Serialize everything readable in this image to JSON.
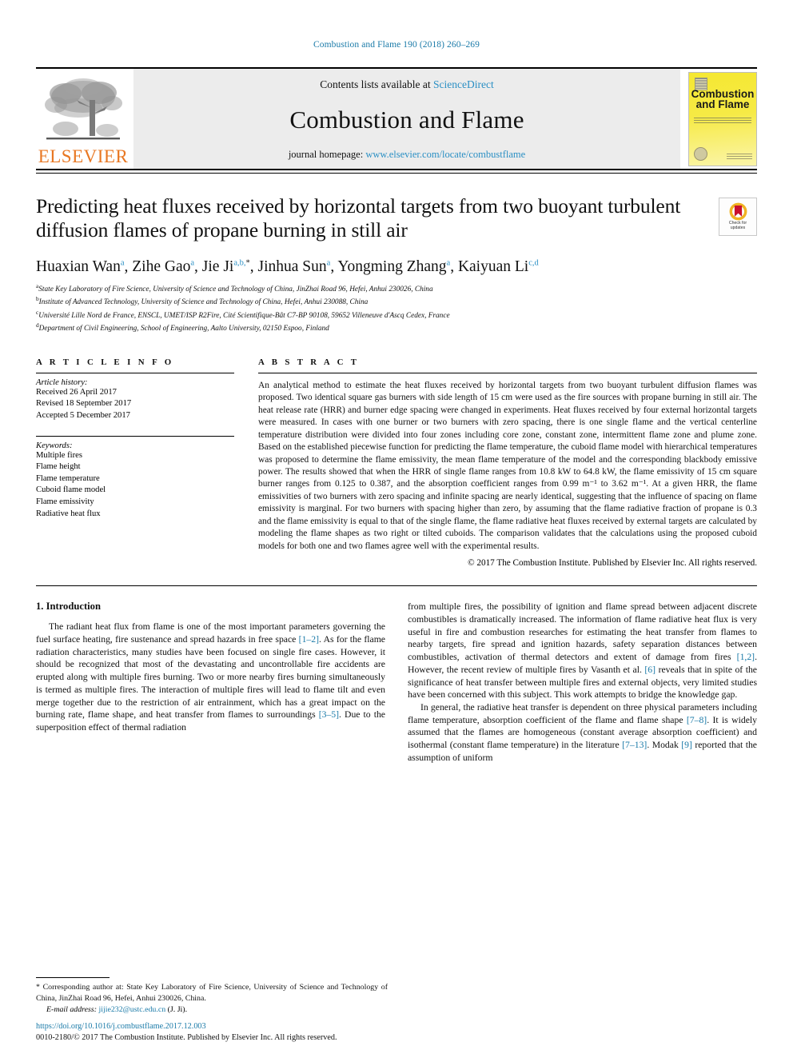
{
  "running_head": "Combustion and Flame 190 (2018) 260–269",
  "masthead": {
    "publisher": "ELSEVIER",
    "contents_prefix": "Contents lists available at ",
    "contents_link": "ScienceDirect",
    "journal_name": "Combustion and Flame",
    "homepage_prefix": "journal homepage: ",
    "homepage_url": "www.elsevier.com/locate/combustflame",
    "cover_title_line1": "Combustion",
    "cover_title_line2": "and Flame"
  },
  "article": {
    "title": "Predicting heat fluxes received by horizontal targets from two buoyant turbulent diffusion flames of propane burning in still air",
    "crossmark_line1": "Check for",
    "crossmark_line2": "updates",
    "authors_html": "Huaxian Wan<sup>a</sup>, Zihe Gao<sup>a</sup>, Jie Ji<sup>a,b,</sup><sup class=\"blk\">*</sup>, Jinhua Sun<sup>a</sup>, Yongming Zhang<sup>a</sup>, Kaiyuan Li<sup>c,d</sup>",
    "affiliations": [
      {
        "marker": "a",
        "text": "State Key Laboratory of Fire Science, University of Science and Technology of China, JinZhai Road 96, Hefei, Anhui 230026, China"
      },
      {
        "marker": "b",
        "text": "Institute of Advanced Technology, University of Science and Technology of China, Hefei, Anhui 230088, China"
      },
      {
        "marker": "c",
        "text": "Université Lille Nord de France, ENSCL, UMET/ISP R2Fire, Cité Scientifique-Bât C7-BP 90108, 59652 Villeneuve d'Ascq Cedex, France"
      },
      {
        "marker": "d",
        "text": "Department of Civil Engineering, School of Engineering, Aalto University, 02150 Espoo, Finland"
      }
    ]
  },
  "article_info": {
    "heading": "A R T I C L E    I N F O",
    "history_label": "Article history:",
    "history": [
      "Received 26 April 2017",
      "Revised 18 September 2017",
      "Accepted 5 December 2017"
    ],
    "keywords_label": "Keywords:",
    "keywords": [
      "Multiple fires",
      "Flame height",
      "Flame temperature",
      "Cuboid flame model",
      "Flame emissivity",
      "Radiative heat flux"
    ]
  },
  "abstract": {
    "heading": "A B S T R A C T",
    "text": "An analytical method to estimate the heat fluxes received by horizontal targets from two buoyant turbulent diffusion flames was proposed. Two identical square gas burners with side length of 15 cm were used as the fire sources with propane burning in still air. The heat release rate (HRR) and burner edge spacing were changed in experiments. Heat fluxes received by four external horizontal targets were measured. In cases with one burner or two burners with zero spacing, there is one single flame and the vertical centerline temperature distribution were divided into four zones including core zone, constant zone, intermittent flame zone and plume zone. Based on the established piecewise function for predicting the flame temperature, the cuboid flame model with hierarchical temperatures was proposed to determine the flame emissivity, the mean flame temperature of the model and the corresponding blackbody emissive power. The results showed that when the HRR of single flame ranges from 10.8 kW to 64.8 kW, the flame emissivity of 15 cm square burner ranges from 0.125 to 0.387, and the absorption coefficient ranges from 0.99 m⁻¹ to 3.62 m⁻¹. At a given HRR, the flame emissivities of two burners with zero spacing and infinite spacing are nearly identical, suggesting that the influence of spacing on flame emissivity is marginal. For two burners with spacing higher than zero, by assuming that the flame radiative fraction of propane is 0.3 and the flame emissivity is equal to that of the single flame, the flame radiative heat fluxes received by external targets are calculated by modeling the flame shapes as two right or tilted cuboids. The comparison validates that the calculations using the proposed cuboid models for both one and two flames agree well with the experimental results.",
    "copyright": "© 2017 The Combustion Institute. Published by Elsevier Inc. All rights reserved."
  },
  "body": {
    "section_title": "1. Introduction",
    "left_paragraphs": [
      "The radiant heat flux from flame is one of the most important parameters governing the fuel surface heating, fire sustenance and spread hazards in free space [1–2]. As for the flame radiation characteristics, many studies have been focused on single fire cases. However, it should be recognized that most of the devastating and uncontrollable fire accidents are erupted along with multiple fires burning. Two or more nearby fires burning simultaneously is termed as multiple fires. The interaction of multiple fires will lead to flame tilt and even merge together due to the restriction of air entrainment, which has a great impact on the burning rate, flame shape, and heat transfer from flames to surroundings [3–5]. Due to the superposition effect of thermal radiation"
    ],
    "right_paragraphs": [
      "from multiple fires, the possibility of ignition and flame spread between adjacent discrete combustibles is dramatically increased. The information of flame radiative heat flux is very useful in fire and combustion researches for estimating the heat transfer from flames to nearby targets, fire spread and ignition hazards, safety separation distances between combustibles, activation of thermal detectors and extent of damage from fires [1,2]. However, the recent review of multiple fires by Vasanth et al. [6] reveals that in spite of the significance of heat transfer between multiple fires and external objects, very limited studies have been concerned with this subject. This work attempts to bridge the knowledge gap.",
      "In general, the radiative heat transfer is dependent on three physical parameters including flame temperature, absorption coefficient of the flame and flame shape [7–8]. It is widely assumed that the flames are homogeneous (constant average absorption coefficient) and isothermal (constant flame temperature) in the literature [7–13]. Modak [9] reported that the assumption of uniform"
    ]
  },
  "footnote": {
    "marker": "*",
    "text": "Corresponding author at: State Key Laboratory of Fire Science, University of Science and Technology of China, JinZhai Road 96, Hefei, Anhui 230026, China.",
    "email_label": "E-mail address:",
    "email": "jijie232@ustc.edu.cn",
    "email_suffix": "(J. Ji)."
  },
  "footer": {
    "doi": "https://doi.org/10.1016/j.combustflame.2017.12.003",
    "issn_copyright": "0010-2180/© 2017 The Combustion Institute. Published by Elsevier Inc. All rights reserved."
  },
  "colors": {
    "link": "#1a7aa8",
    "sciencedirect": "#2a8fc4",
    "elsevier_orange": "#E87722",
    "cover_yellow": "#f5e832"
  }
}
